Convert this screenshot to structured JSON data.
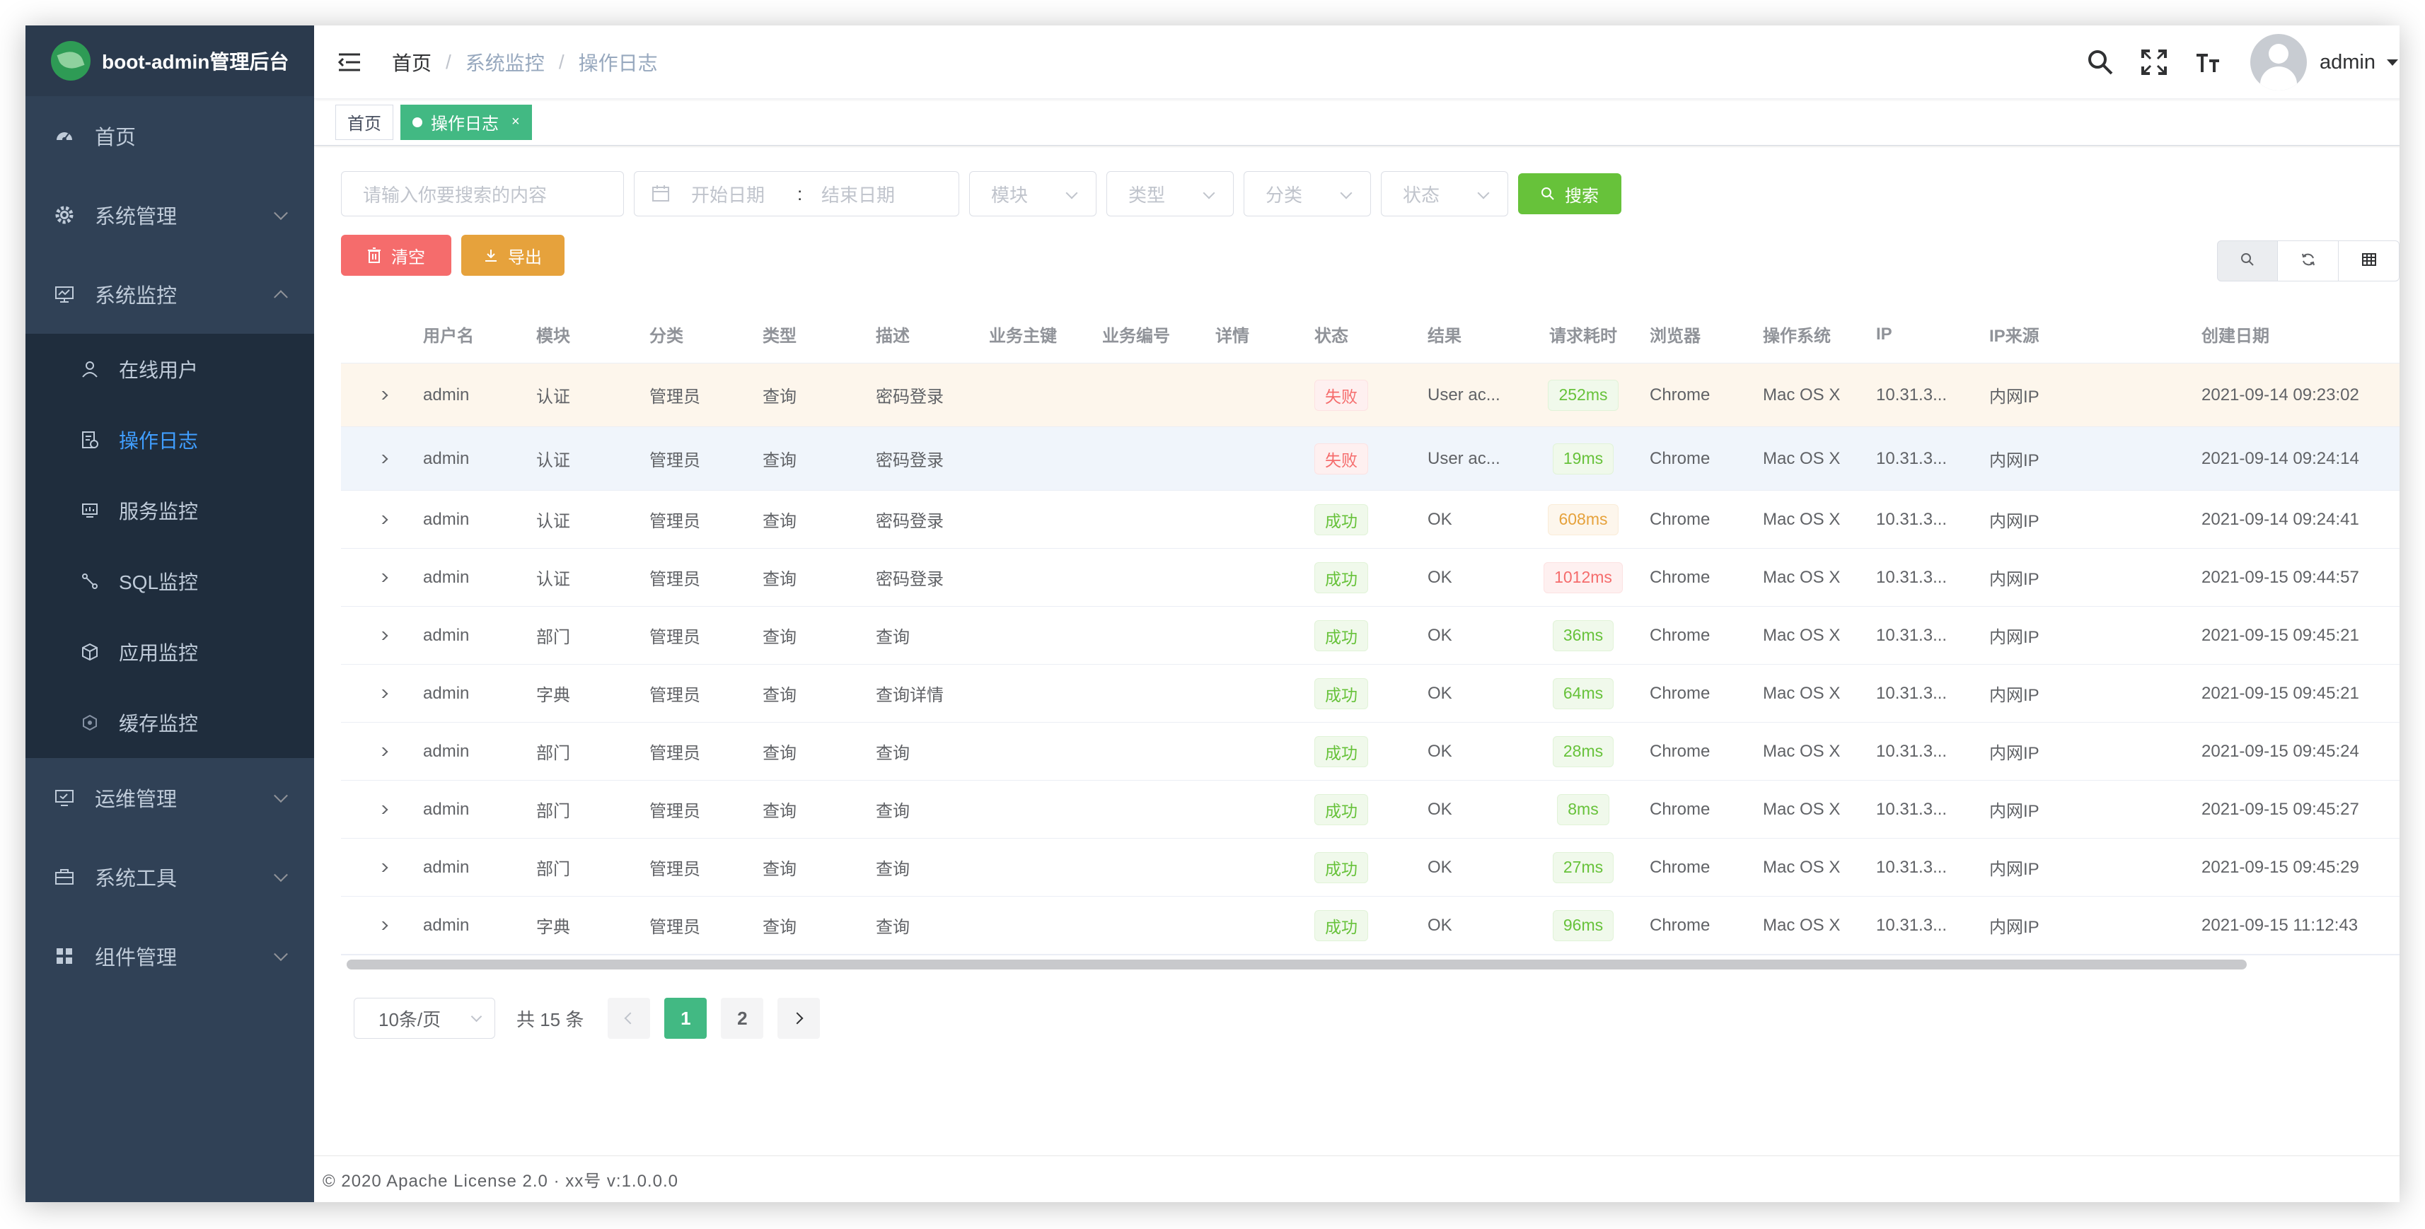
{
  "app": {
    "title": "boot-admin管理后台"
  },
  "colors": {
    "sidebar_bg": "#304156",
    "accent": "#42b983",
    "link_active": "#409eff"
  },
  "sidebar": {
    "items": [
      {
        "label": "首页",
        "icon": "dashboard-icon"
      },
      {
        "label": "系统管理",
        "icon": "gear-icon",
        "expandable": true
      },
      {
        "label": "系统监控",
        "icon": "monitor-icon",
        "expanded": true
      },
      {
        "label": "运维管理",
        "icon": "screen-icon",
        "expandable": true
      },
      {
        "label": "系统工具",
        "icon": "toolbox-icon",
        "expandable": true
      },
      {
        "label": "组件管理",
        "icon": "grid-icon",
        "expandable": true
      }
    ],
    "sub_items": [
      {
        "label": "在线用户",
        "icon": "online-user-icon"
      },
      {
        "label": "操作日志",
        "icon": "log-icon",
        "active": true
      },
      {
        "label": "服务监控",
        "icon": "server-icon"
      },
      {
        "label": "SQL监控",
        "icon": "sql-icon"
      },
      {
        "label": "应用监控",
        "icon": "cube-icon"
      },
      {
        "label": "缓存监控",
        "icon": "cache-icon"
      }
    ]
  },
  "breadcrumb": [
    "首页",
    "系统监控",
    "操作日志"
  ],
  "user": {
    "name": "admin"
  },
  "tags": [
    {
      "label": "首页",
      "active": false
    },
    {
      "label": "操作日志",
      "active": true,
      "close": "×"
    }
  ],
  "search": {
    "keyword_placeholder": "请输入你要搜索的内容",
    "start_date_placeholder": "开始日期",
    "range_separator": ":",
    "end_date_placeholder": "结束日期",
    "module_placeholder": "模块",
    "type_placeholder": "类型",
    "category_placeholder": "分类",
    "status_placeholder": "状态",
    "search_label": "搜索"
  },
  "actions": {
    "clear_label": "清空",
    "export_label": "导出"
  },
  "table": {
    "columns": [
      "",
      "用户名",
      "模块",
      "分类",
      "类型",
      "描述",
      "业务主键",
      "业务编号",
      "详情",
      "状态",
      "结果",
      "请求耗时",
      "浏览器",
      "操作系统",
      "IP",
      "IP来源",
      "创建日期"
    ],
    "rows": [
      {
        "user": "admin",
        "module": "认证",
        "category": "管理员",
        "type": "查询",
        "desc": "密码登录",
        "status": "失败",
        "status_kind": "fail",
        "result": "User ac...",
        "duration": "252ms",
        "dur_kind": "green",
        "browser": "Chrome",
        "os": "Mac OS X",
        "ip": "10.31.3...",
        "ip_source": "内网IP",
        "created": "2021-09-14 09:23:02"
      },
      {
        "user": "admin",
        "module": "认证",
        "category": "管理员",
        "type": "查询",
        "desc": "密码登录",
        "status": "失败",
        "status_kind": "fail",
        "result": "User ac...",
        "duration": "19ms",
        "dur_kind": "green",
        "browser": "Chrome",
        "os": "Mac OS X",
        "ip": "10.31.3...",
        "ip_source": "内网IP",
        "created": "2021-09-14 09:24:14"
      },
      {
        "user": "admin",
        "module": "认证",
        "category": "管理员",
        "type": "查询",
        "desc": "密码登录",
        "status": "成功",
        "status_kind": "ok",
        "result": "OK",
        "duration": "608ms",
        "dur_kind": "orange",
        "browser": "Chrome",
        "os": "Mac OS X",
        "ip": "10.31.3...",
        "ip_source": "内网IP",
        "created": "2021-09-14 09:24:41"
      },
      {
        "user": "admin",
        "module": "认证",
        "category": "管理员",
        "type": "查询",
        "desc": "密码登录",
        "status": "成功",
        "status_kind": "ok",
        "result": "OK",
        "duration": "1012ms",
        "dur_kind": "red",
        "browser": "Chrome",
        "os": "Mac OS X",
        "ip": "10.31.3...",
        "ip_source": "内网IP",
        "created": "2021-09-15 09:44:57"
      },
      {
        "user": "admin",
        "module": "部门",
        "category": "管理员",
        "type": "查询",
        "desc": "查询",
        "status": "成功",
        "status_kind": "ok",
        "result": "OK",
        "duration": "36ms",
        "dur_kind": "green",
        "browser": "Chrome",
        "os": "Mac OS X",
        "ip": "10.31.3...",
        "ip_source": "内网IP",
        "created": "2021-09-15 09:45:21"
      },
      {
        "user": "admin",
        "module": "字典",
        "category": "管理员",
        "type": "查询",
        "desc": "查询详情",
        "status": "成功",
        "status_kind": "ok",
        "result": "OK",
        "duration": "64ms",
        "dur_kind": "green",
        "browser": "Chrome",
        "os": "Mac OS X",
        "ip": "10.31.3...",
        "ip_source": "内网IP",
        "created": "2021-09-15 09:45:21"
      },
      {
        "user": "admin",
        "module": "部门",
        "category": "管理员",
        "type": "查询",
        "desc": "查询",
        "status": "成功",
        "status_kind": "ok",
        "result": "OK",
        "duration": "28ms",
        "dur_kind": "green",
        "browser": "Chrome",
        "os": "Mac OS X",
        "ip": "10.31.3...",
        "ip_source": "内网IP",
        "created": "2021-09-15 09:45:24"
      },
      {
        "user": "admin",
        "module": "部门",
        "category": "管理员",
        "type": "查询",
        "desc": "查询",
        "status": "成功",
        "status_kind": "ok",
        "result": "OK",
        "duration": "8ms",
        "dur_kind": "green",
        "browser": "Chrome",
        "os": "Mac OS X",
        "ip": "10.31.3...",
        "ip_source": "内网IP",
        "created": "2021-09-15 09:45:27"
      },
      {
        "user": "admin",
        "module": "部门",
        "category": "管理员",
        "type": "查询",
        "desc": "查询",
        "status": "成功",
        "status_kind": "ok",
        "result": "OK",
        "duration": "27ms",
        "dur_kind": "green",
        "browser": "Chrome",
        "os": "Mac OS X",
        "ip": "10.31.3...",
        "ip_source": "内网IP",
        "created": "2021-09-15 09:45:29"
      },
      {
        "user": "admin",
        "module": "字典",
        "category": "管理员",
        "type": "查询",
        "desc": "查询",
        "status": "成功",
        "status_kind": "ok",
        "result": "OK",
        "duration": "96ms",
        "dur_kind": "green",
        "browser": "Chrome",
        "os": "Mac OS X",
        "ip": "10.31.3...",
        "ip_source": "内网IP",
        "created": "2021-09-15 11:12:43"
      }
    ]
  },
  "pagination": {
    "page_size": "10条/页",
    "total": "共 15 条",
    "pages": [
      "1",
      "2"
    ],
    "current": "1"
  },
  "footer": {
    "text": "© 2020 Apache License 2.0 · xx号 v:1.0.0.0"
  }
}
